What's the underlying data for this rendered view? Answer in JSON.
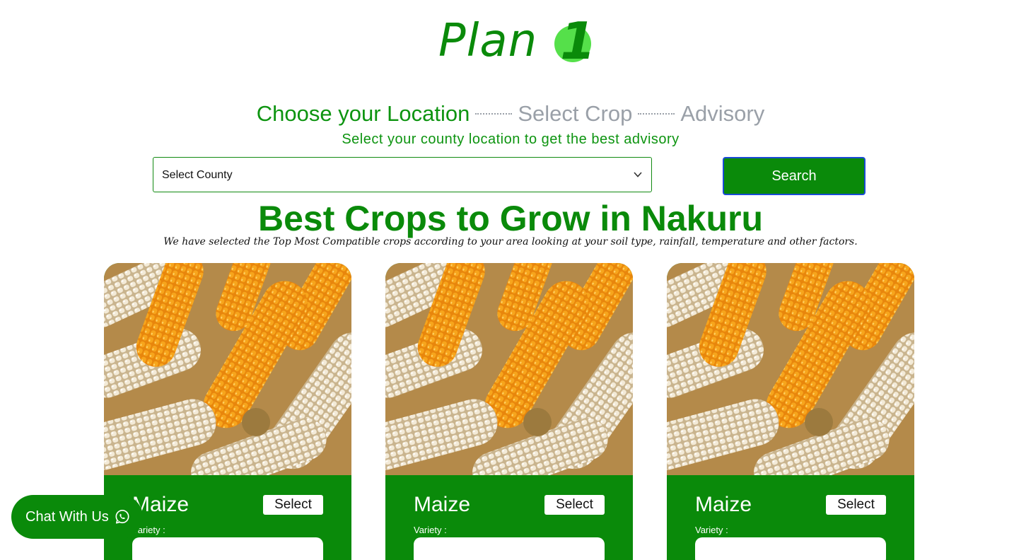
{
  "logo": {
    "text": "Plan",
    "badge": "1",
    "brand_color": "#0a8a0a",
    "badge_color": "#55e04a"
  },
  "steps": [
    {
      "label": "Choose your Location",
      "state": "active"
    },
    {
      "label": "Select Crop",
      "state": "inactive"
    },
    {
      "label": "Advisory",
      "state": "inactive"
    }
  ],
  "subtitle": "Select your county location to get the best advisory",
  "county_select": {
    "value": "Select County",
    "icon": "chevron-down-icon"
  },
  "search_button": {
    "label": "Search"
  },
  "section": {
    "title": "Best Crops to Grow in Nakuru",
    "description": "We have selected the Top Most Compatible crops according to your area looking at your soil type, rainfall, temperature and other factors."
  },
  "crops": [
    {
      "name": "Maize",
      "select_label": "Select",
      "variety_label": "Variety :"
    },
    {
      "name": "Maize",
      "select_label": "Select",
      "variety_label": "Variety :"
    },
    {
      "name": "Maize",
      "select_label": "Select",
      "variety_label": "Variety :"
    }
  ],
  "chat_button": {
    "label": "Chat With Us",
    "icon": "whatsapp-icon"
  },
  "colors": {
    "primary_green": "#0a8a0a",
    "step_inactive": "#9aa0a8",
    "search_border": "#1a4bd6"
  }
}
